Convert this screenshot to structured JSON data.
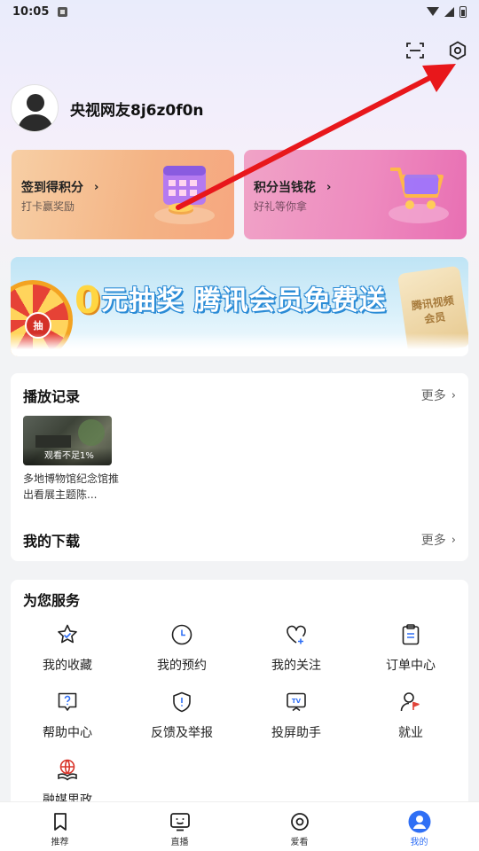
{
  "status_bar": {
    "time": "10:05"
  },
  "profile": {
    "username": "央视网友8j6z0f0n"
  },
  "promo_cards": [
    {
      "title": "签到得积分",
      "subtitle": "打卡赢奖励"
    },
    {
      "title": "积分当钱花",
      "subtitle": "好礼等你拿"
    }
  ],
  "banner": {
    "zero": "0",
    "text": "元抽奖 腾讯会员免费送",
    "wheel_center": "抽",
    "card_line1": "腾讯视频",
    "card_line2": "会员"
  },
  "history": {
    "title": "播放记录",
    "more": "更多",
    "video": {
      "progress": "观看不足1%",
      "title": "多地博物馆纪念馆推出看展主题陈..."
    },
    "downloads_title": "我的下载",
    "downloads_more": "更多"
  },
  "services": {
    "title": "为您服务",
    "items": [
      {
        "label": "我的收藏",
        "icon": "star-icon"
      },
      {
        "label": "我的预约",
        "icon": "clock-icon"
      },
      {
        "label": "我的关注",
        "icon": "heart-plus-icon"
      },
      {
        "label": "订单中心",
        "icon": "clipboard-icon"
      },
      {
        "label": "帮助中心",
        "icon": "help-icon"
      },
      {
        "label": "反馈及举报",
        "icon": "shield-alert-icon"
      },
      {
        "label": "投屏助手",
        "icon": "tv-cast-icon"
      },
      {
        "label": "就业",
        "icon": "employment-icon"
      },
      {
        "label": "融媒思政",
        "icon": "globe-book-icon"
      }
    ]
  },
  "tabbar": {
    "items": [
      {
        "label": "推荐",
        "icon": "bookmark-icon"
      },
      {
        "label": "直播",
        "icon": "tv-face-icon"
      },
      {
        "label": "爱看",
        "icon": "target-icon"
      },
      {
        "label": "我的",
        "icon": "profile-icon",
        "active": true
      }
    ]
  },
  "colors": {
    "accent": "#2f6ff5",
    "annotation": "#e8171b"
  }
}
